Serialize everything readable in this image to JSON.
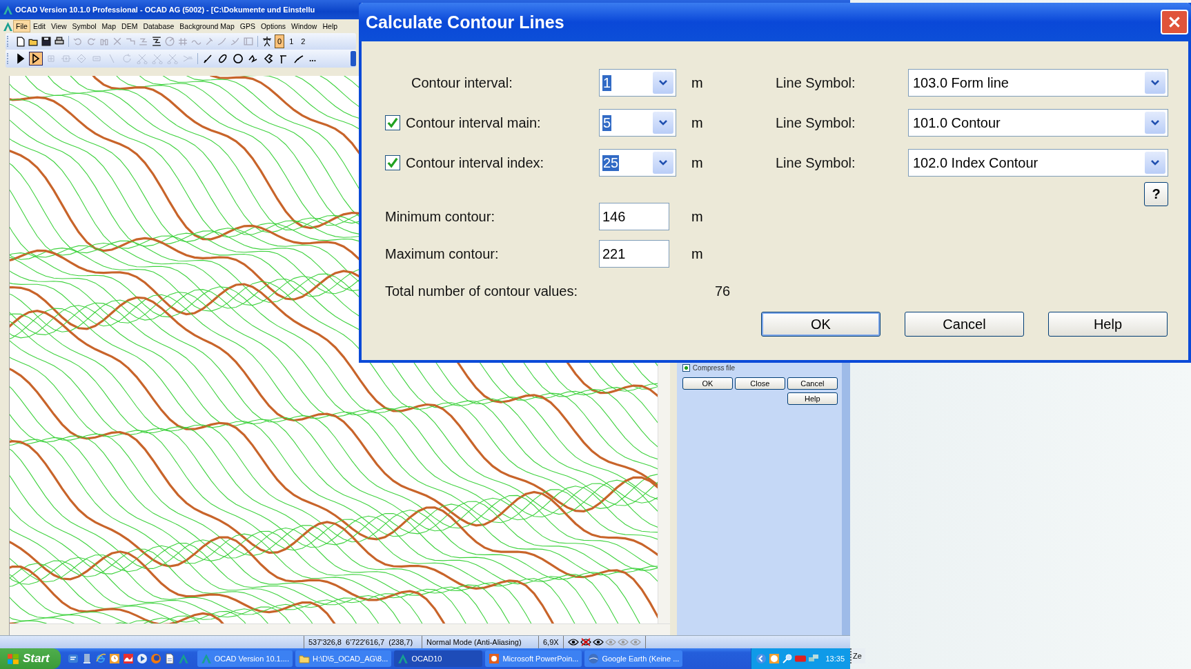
{
  "main_window": {
    "title": "OCAD Version 10.1.0  Professional - OCAD AG (5002) - [C:\\Dokumente und Einstellu",
    "menu": [
      {
        "label": "File",
        "selected": true
      },
      {
        "label": "Edit",
        "selected": false
      },
      {
        "label": "View",
        "selected": false
      },
      {
        "label": "Symbol",
        "selected": false
      },
      {
        "label": "Map",
        "selected": false
      },
      {
        "label": "DEM",
        "selected": false
      },
      {
        "label": "Database",
        "selected": false
      },
      {
        "label": "Background Map",
        "selected": false
      },
      {
        "label": "GPS",
        "selected": false
      },
      {
        "label": "Options",
        "selected": false
      },
      {
        "label": "Window",
        "selected": false
      },
      {
        "label": "Help",
        "selected": false
      }
    ],
    "file_toolbar": [
      {
        "kind": "new-file",
        "disabled": false
      },
      {
        "kind": "open",
        "disabled": false
      },
      {
        "kind": "save",
        "disabled": false
      },
      {
        "kind": "print",
        "disabled": false
      },
      {
        "kind": "separator"
      },
      {
        "kind": "undo",
        "disabled": true
      },
      {
        "kind": "redo",
        "disabled": true
      },
      {
        "kind": "find",
        "disabled": true
      },
      {
        "kind": "delete",
        "disabled": true
      },
      {
        "kind": "step-a",
        "disabled": true
      },
      {
        "kind": "step-b",
        "disabled": true
      },
      {
        "kind": "step-c",
        "disabled": false
      },
      {
        "kind": "target",
        "disabled": true
      },
      {
        "kind": "hash",
        "disabled": true
      },
      {
        "kind": "wave",
        "disabled": true
      },
      {
        "kind": "pin",
        "disabled": true
      },
      {
        "kind": "curve-a",
        "disabled": true
      },
      {
        "kind": "curve-b",
        "disabled": true
      },
      {
        "kind": "frame",
        "disabled": true
      },
      {
        "kind": "separator"
      },
      {
        "kind": "person",
        "disabled": false
      }
    ],
    "layer_buttons": [
      {
        "label": "0",
        "selected": true
      },
      {
        "label": "1",
        "selected": false
      },
      {
        "label": "2",
        "selected": false
      }
    ],
    "tools": [
      {
        "kind": "pointer",
        "selected": false,
        "disabled": false
      },
      {
        "kind": "edit-pointer",
        "selected": true,
        "disabled": false
      },
      {
        "kind": "add-point",
        "selected": false,
        "disabled": true
      },
      {
        "kind": "dash-point",
        "selected": false,
        "disabled": true
      },
      {
        "kind": "corner-point",
        "selected": false,
        "disabled": true
      },
      {
        "kind": "remove-point",
        "selected": false,
        "disabled": true
      },
      {
        "kind": "line",
        "selected": false,
        "disabled": true
      },
      {
        "kind": "rotate",
        "selected": false,
        "disabled": true
      },
      {
        "kind": "scissors",
        "selected": false,
        "disabled": true
      },
      {
        "kind": "scissors",
        "selected": false,
        "disabled": true
      },
      {
        "kind": "scissors",
        "selected": false,
        "disabled": true
      },
      {
        "kind": "merge",
        "selected": false,
        "disabled": true
      },
      {
        "kind": "separator"
      },
      {
        "kind": "pen",
        "selected": false,
        "disabled": false
      },
      {
        "kind": "ellipse",
        "selected": false,
        "disabled": false
      },
      {
        "kind": "circle",
        "selected": false,
        "disabled": false
      },
      {
        "kind": "zigzag",
        "selected": false,
        "disabled": false
      },
      {
        "kind": "rectangle",
        "selected": false,
        "disabled": false
      },
      {
        "kind": "corner",
        "selected": false,
        "disabled": false
      },
      {
        "kind": "bezier",
        "selected": false,
        "disabled": false
      }
    ],
    "more_tools": "...",
    "side_panel": {
      "compress_file": {
        "label": "Compress file",
        "checked": true
      },
      "buttons": [
        "OK",
        "Close",
        "Cancel",
        "Help"
      ]
    },
    "status_bar": {
      "coordinates": "537'326,8   6'722'616,7   (238,7)",
      "mode": "Normal Mode (Anti-Aliasing)",
      "zoom": "6,9X",
      "views": [
        {
          "kind": "visible"
        },
        {
          "kind": "hidden"
        },
        {
          "kind": "visible"
        },
        {
          "kind": "dimmed"
        },
        {
          "kind": "dimmed"
        },
        {
          "kind": "dimmed"
        }
      ]
    }
  },
  "taskbar": {
    "start": "Start",
    "tasks": [
      {
        "label": "OCAD Version 10.1....",
        "kind": "ocad",
        "selected": false
      },
      {
        "label": "H:\\D\\5_OCAD_AG\\8...",
        "kind": "folder",
        "selected": false
      },
      {
        "label": "OCAD10",
        "kind": "ocad",
        "selected": true
      },
      {
        "label": "Microsoft PowerPoin...",
        "kind": "powerpoint",
        "selected": false
      },
      {
        "label": "Google Earth (Keine ...",
        "kind": "earth",
        "selected": false
      }
    ],
    "clock": "13:35"
  },
  "side_toolbar_label": "Ze",
  "dialog": {
    "title": "Calculate Contour Lines",
    "rows": [
      {
        "kind": "plain",
        "label": "Contour interval:",
        "value": "1",
        "unit": "m",
        "symbol_label": "Line Symbol:",
        "symbol": "103.0 Form line"
      },
      {
        "kind": "checkbox",
        "checked": true,
        "label": "Contour interval main:",
        "value": "5",
        "unit": "m",
        "symbol_label": "Line Symbol:",
        "symbol": "101.0 Contour"
      },
      {
        "kind": "checkbox",
        "checked": true,
        "label": "Contour interval index:",
        "value": "25",
        "unit": "m",
        "symbol_label": "Line Symbol:",
        "symbol": "102.0 Index Contour"
      }
    ],
    "minimum": {
      "label": "Minimum contour:",
      "value": "146",
      "unit": "m"
    },
    "maximum": {
      "label": "Maximum contour:",
      "value": "221",
      "unit": "m"
    },
    "total": {
      "label": "Total number of contour values:",
      "value": "76"
    },
    "help_icon": "?",
    "buttons": [
      "OK",
      "Cancel",
      "Help"
    ]
  }
}
